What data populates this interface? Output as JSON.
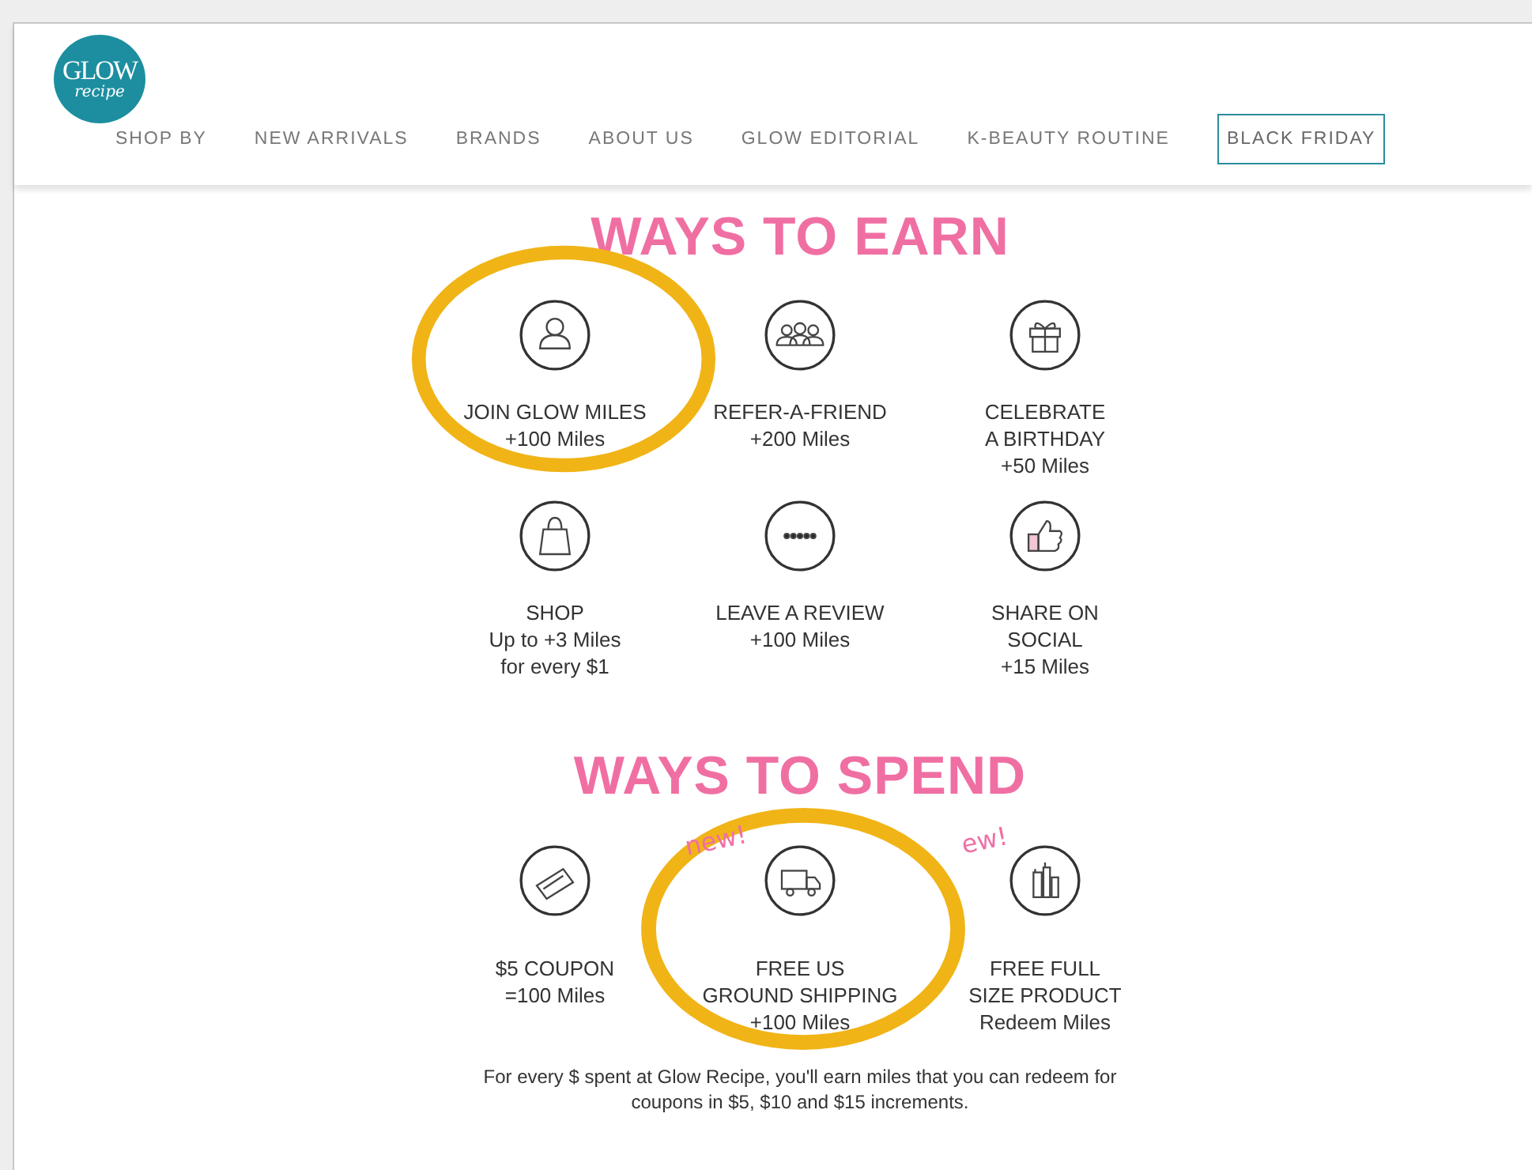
{
  "logo": {
    "top": "GLOW",
    "bottom": "recipe"
  },
  "nav": [
    {
      "label": "SHOP BY",
      "kind": "link"
    },
    {
      "label": "NEW ARRIVALS",
      "kind": "link"
    },
    {
      "label": "BRANDS",
      "kind": "link"
    },
    {
      "label": "ABOUT US",
      "kind": "link"
    },
    {
      "label": "GLOW EDITORIAL",
      "kind": "link"
    },
    {
      "label": "K-BEAUTY ROUTINE",
      "kind": "link"
    },
    {
      "label": "BLACK FRIDAY",
      "kind": "boxed"
    }
  ],
  "sections": [
    {
      "title": "WAYS TO EARN",
      "items": [
        {
          "kind": "person",
          "lines": [
            "JOIN GLOW MILES",
            "+100 Miles"
          ],
          "highlighted": true
        },
        {
          "kind": "group",
          "lines": [
            "REFER-A-FRIEND",
            "+200 Miles"
          ],
          "highlighted": false
        },
        {
          "kind": "gift",
          "lines": [
            "CELEBRATE",
            "A BIRTHDAY",
            "+50 Miles"
          ],
          "highlighted": false
        },
        {
          "kind": "bag",
          "lines": [
            "SHOP",
            "Up to +3 Miles",
            "for every $1"
          ],
          "highlighted": false
        },
        {
          "kind": "stars",
          "lines": [
            "LEAVE A REVIEW",
            "+100 Miles"
          ],
          "highlighted": false
        },
        {
          "kind": "thumb",
          "lines": [
            "SHARE ON",
            "SOCIAL",
            "+15 Miles"
          ],
          "highlighted": false
        }
      ]
    },
    {
      "title": "WAYS TO SPEND",
      "items": [
        {
          "kind": "ticket",
          "lines": [
            "$5 COUPON",
            "=100 Miles"
          ],
          "highlighted": false
        },
        {
          "kind": "truck",
          "lines": [
            "FREE US",
            "GROUND SHIPPING",
            "+100 Miles"
          ],
          "highlighted": true,
          "tag": "new!"
        },
        {
          "kind": "bottles",
          "lines": [
            "FREE FULL",
            "SIZE PRODUCT",
            "Redeem Miles"
          ],
          "highlighted": false,
          "tag": "ew!"
        }
      ],
      "note": "For every $ spent at Glow Recipe, you'll earn miles that you can redeem for coupons in $5, $10 and $15 increments."
    }
  ]
}
